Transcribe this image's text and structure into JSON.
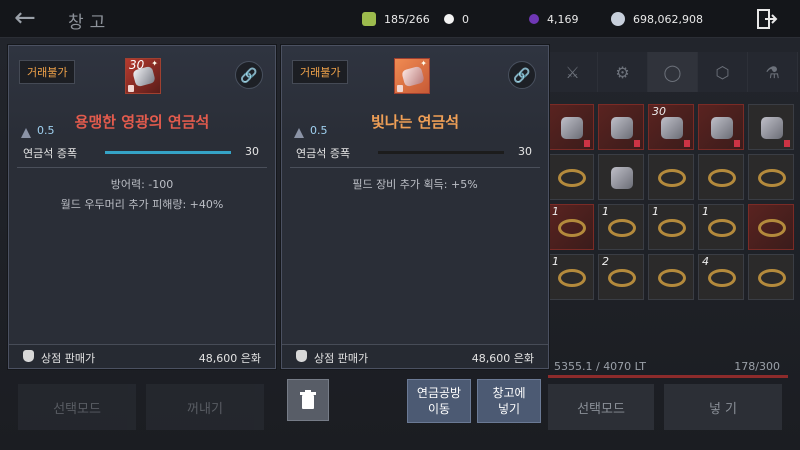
{
  "topbar": {
    "title": "창고",
    "capacity": "185/266",
    "pearls": "0",
    "purple_currency": "4,169",
    "silver": "698,062,908"
  },
  "background": {
    "weight": "5355.1 / 4070 LT",
    "slots": "178/300",
    "left_mode_button": "선택모드",
    "take_out_button": "꺼내기",
    "right_mode_button": "선택모드",
    "put_in_button": "넣 기"
  },
  "panel_left": {
    "trade_label": "거래불가",
    "stack_count": "30",
    "name": "용맹한 영광의 연금석",
    "weight": "0.5",
    "upgrade_label": "연금석 증폭",
    "upgrade_value": "30",
    "effects": [
      "방어력: -100",
      "월드 우두머리 추가 피해량: +40%"
    ],
    "shop_label": "상점 판매가",
    "shop_price": "48,600 은화",
    "name_color": "#e25b4d",
    "bar_color": "#35a3c6"
  },
  "panel_right": {
    "trade_label": "거래불가",
    "name": "빛나는 연금석",
    "weight": "0.5",
    "upgrade_label": "연금석 증폭",
    "upgrade_value": "30",
    "effects": [
      "필드 장비 추가 획득: +5%"
    ],
    "shop_label": "상점 판매가",
    "shop_price": "48,600 은화",
    "name_color": "#ef9f56",
    "bar_color": "#1c1c1c"
  },
  "actions": {
    "workshop_line1": "연금공방",
    "workshop_line2": "이동",
    "store_line1": "창고에",
    "store_line2": "넣기"
  },
  "grid": {
    "counts": [
      "",
      "",
      "30",
      "",
      "",
      "",
      "",
      "",
      "",
      "",
      "1",
      "1",
      "1",
      "1",
      "",
      "1",
      "2",
      "",
      "4",
      ""
    ]
  }
}
